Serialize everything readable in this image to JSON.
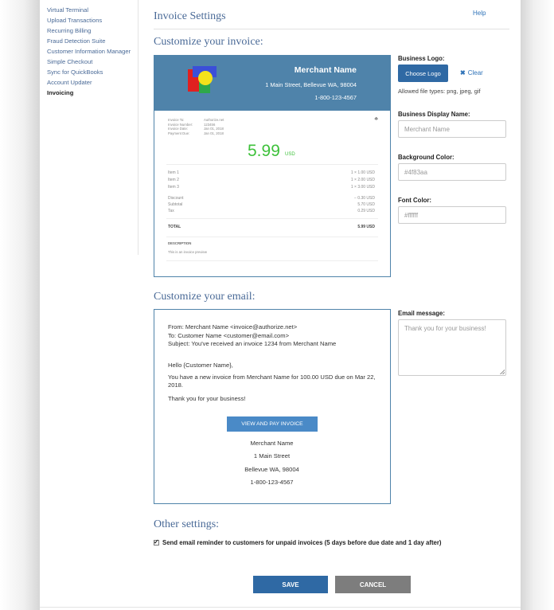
{
  "sidebar": {
    "items": [
      {
        "label": "Virtual Terminal"
      },
      {
        "label": "Upload Transactions"
      },
      {
        "label": "Recurring Billing"
      },
      {
        "label": "Fraud Detection Suite"
      },
      {
        "label": "Customer Information Manager"
      },
      {
        "label": "Simple Checkout"
      },
      {
        "label": "Sync for QuickBooks"
      },
      {
        "label": "Account Updater"
      },
      {
        "label": "Invoicing",
        "active": true
      }
    ]
  },
  "header": {
    "title": "Invoice Settings",
    "help": "Help"
  },
  "invoice_section": {
    "heading": "Customize your invoice:",
    "preview": {
      "merchant_name": "Merchant Name",
      "address": "1 Main Street, Bellevue WA, 98004",
      "phone": "1-800-123-4567",
      "meta_labels": [
        "Invoice To:",
        "Invoice Number:",
        "Invoice Date:",
        "Payment Due:"
      ],
      "meta_values": [
        "Authorize.net",
        "123456",
        "Jan 01, 2018",
        "Jan 01, 2018"
      ],
      "amount": "5.99",
      "currency": "USD",
      "items": [
        {
          "label": "Item 1",
          "value": "1 × 1.00 USD"
        },
        {
          "label": "Item 2",
          "value": "1 × 2.00 USD"
        },
        {
          "label": "Item 3",
          "value": "1 × 3.00 USD"
        }
      ],
      "adjustments": [
        {
          "label": "Discount",
          "value": "− 0.30 USD"
        },
        {
          "label": "Subtotal",
          "value": "5.70 USD"
        },
        {
          "label": "Tax",
          "value": "0.29 USD"
        }
      ],
      "total_label": "TOTAL",
      "total_value": "5.99 USD",
      "description_label": "DESCRIPTION",
      "description_text": "This is an invoice preview"
    },
    "logo": {
      "label": "Business Logo:",
      "choose_label": "Choose Logo",
      "clear_label": "Clear",
      "hint": "Allowed file types: png, jpeg, gif"
    },
    "display_name": {
      "label": "Business Display Name:",
      "placeholder": "Merchant Name"
    },
    "bg_color": {
      "label": "Background Color:",
      "value": "#4f83aa"
    },
    "font_color": {
      "label": "Font Color:",
      "value": "#ffffff"
    }
  },
  "email_section": {
    "heading": "Customize your email:",
    "preview": {
      "from": "From: Merchant Name <invoice@authorize.net>",
      "to": "To: Customer Name <customer@email.com>",
      "subject": "Subject: You've received an invoice 1234 from Merchant Name",
      "greeting": "Hello {Customer Name},",
      "body_line1": "You have a new invoice from Merchant Name for 100.00 USD due on Mar 22,",
      "body_line2": "2018.",
      "thanks": "Thank you for your business!",
      "button": "VIEW AND PAY INVOICE",
      "merchant_name": "Merchant Name",
      "street": "1 Main Street",
      "city": "Bellevue WA, 98004",
      "phone": "1-800-123-4567"
    },
    "message": {
      "label": "Email message:",
      "placeholder": "Thank you for your business!"
    }
  },
  "other": {
    "heading": "Other settings:",
    "reminder_label": "Send email reminder to customers for unpaid invoices (5 days before due date and 1 day after)",
    "reminder_checked": true
  },
  "actions": {
    "save": "SAVE",
    "cancel": "CANCEL"
  },
  "colors": {
    "accent": "#4f83aa",
    "button_primary": "#2f69a4",
    "amount_green": "#3ec13b",
    "cancel_gray": "#7d7d7d"
  }
}
